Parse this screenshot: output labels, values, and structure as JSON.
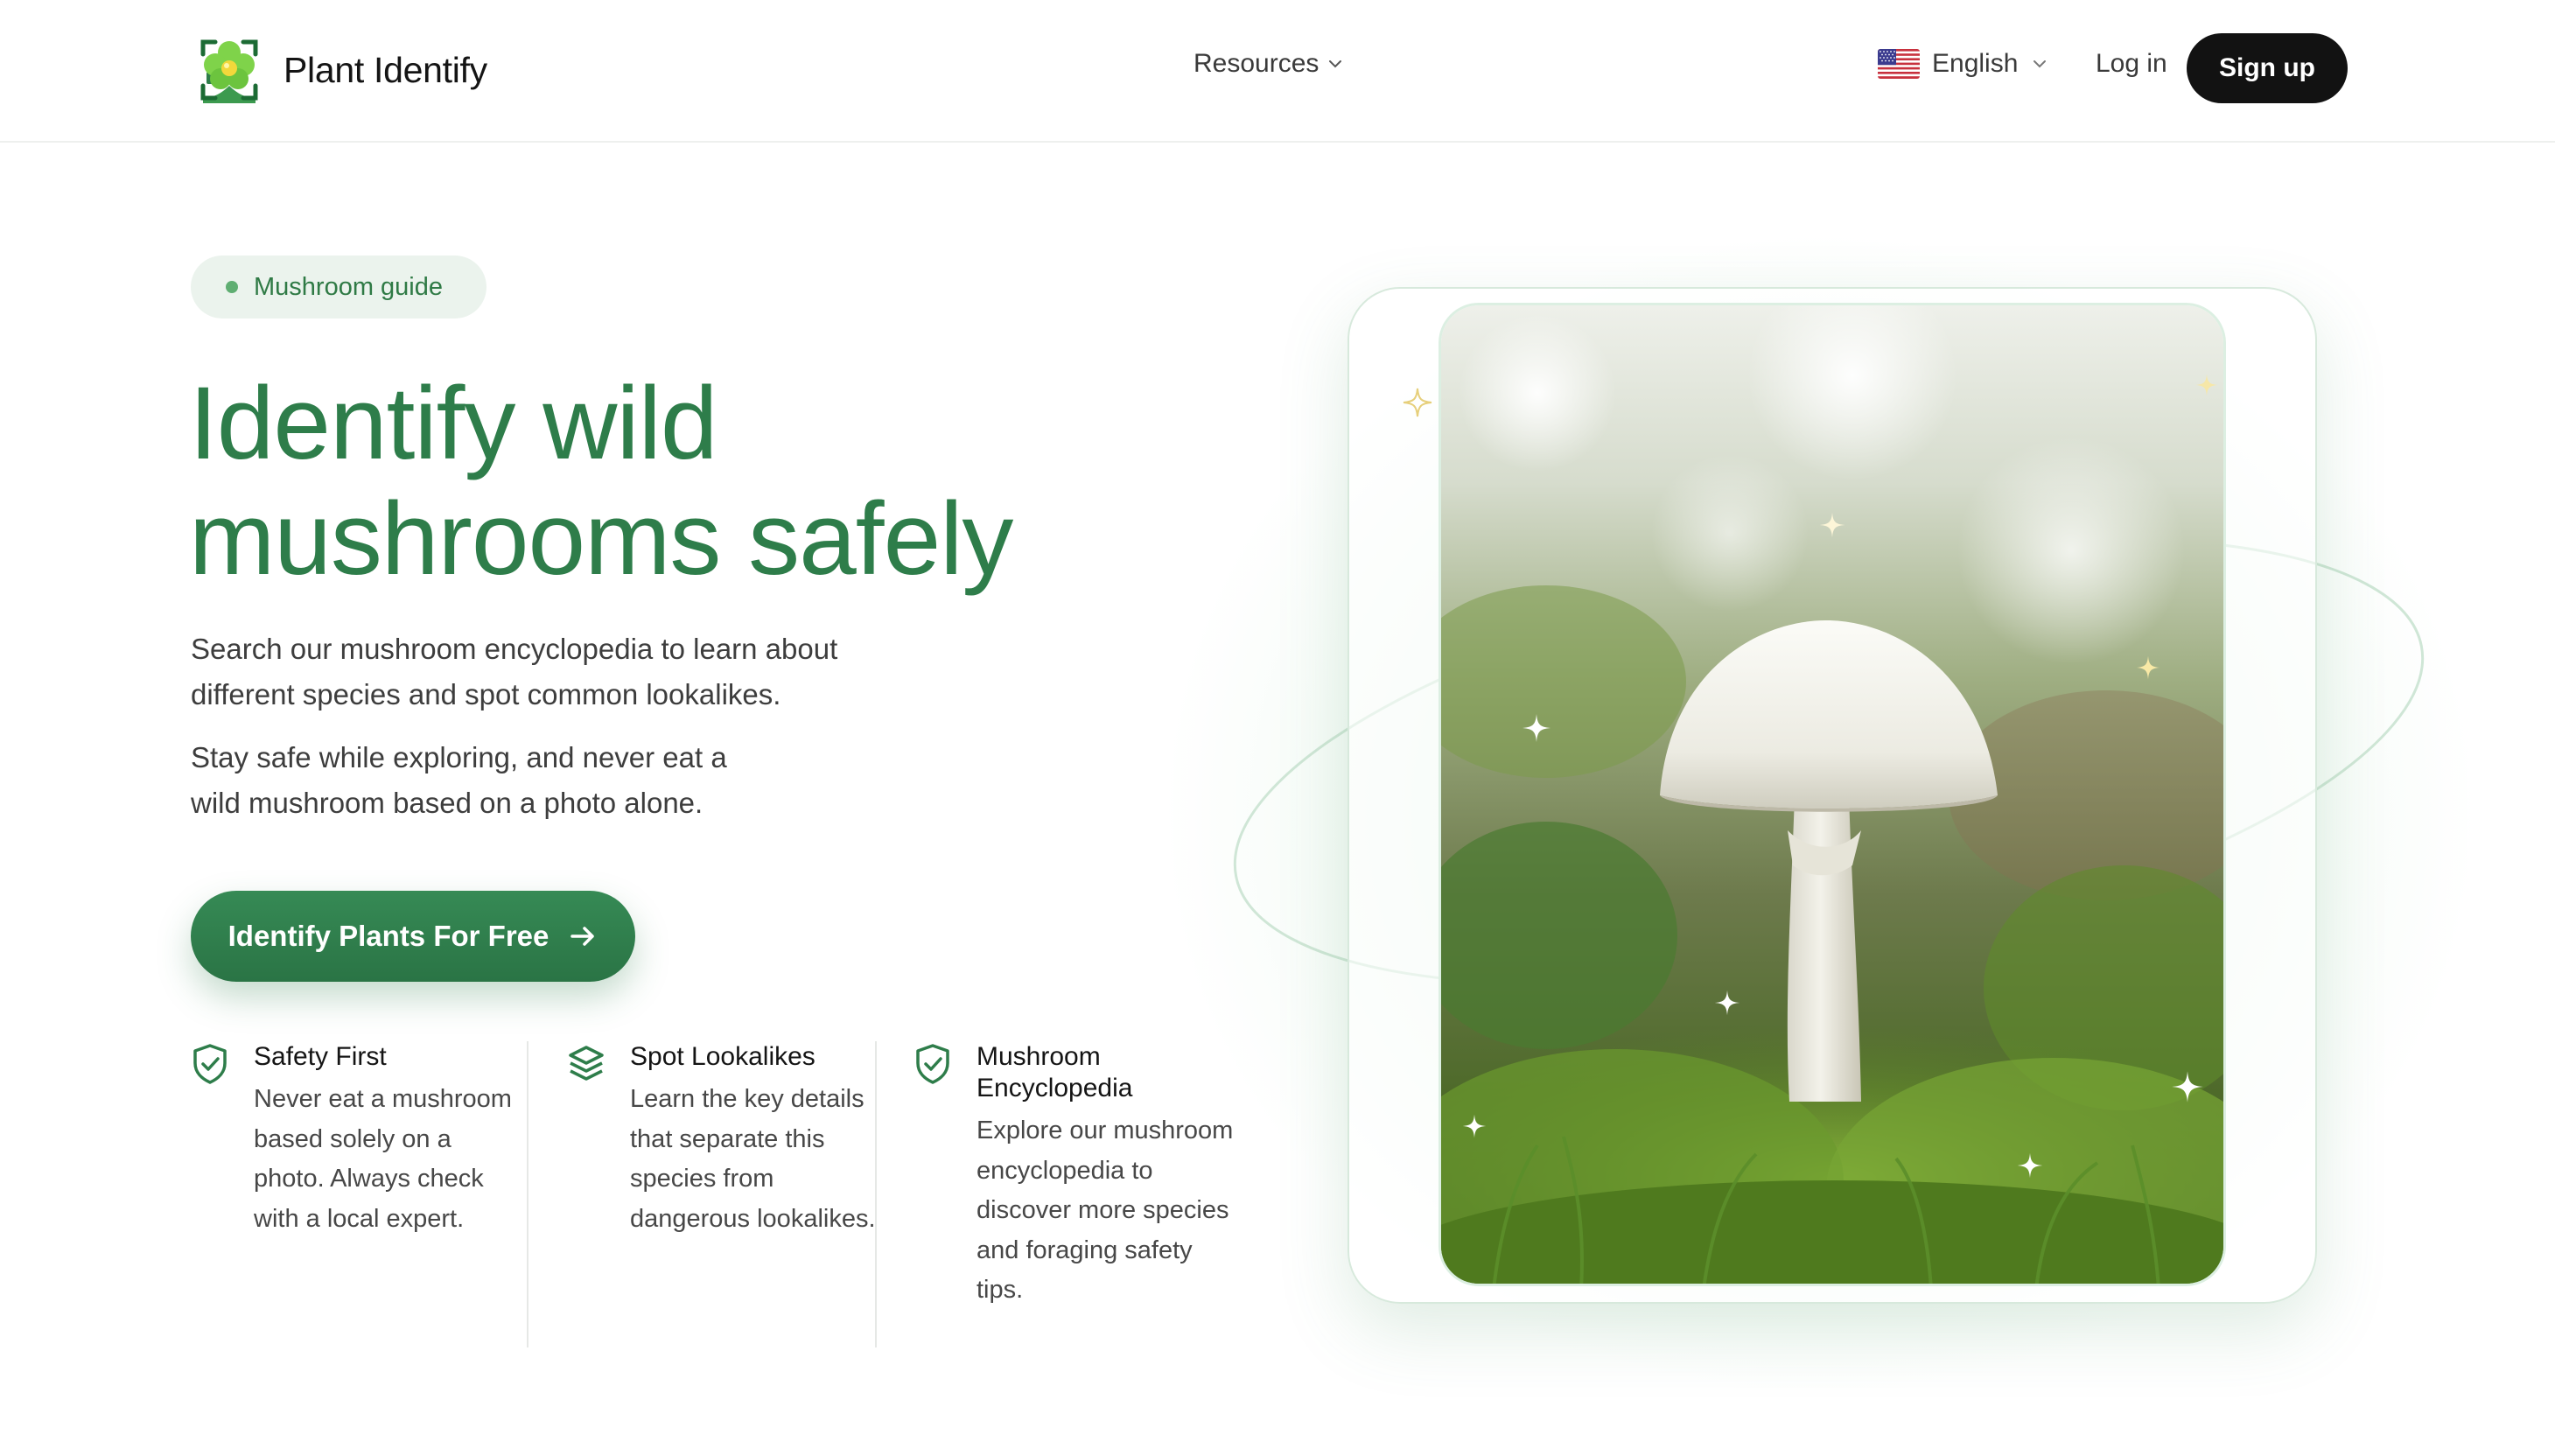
{
  "header": {
    "brand_name": "Plant Identify",
    "logo_icon": "flower-logo-icon",
    "nav_resources": "Resources",
    "language": "English",
    "flag_icon": "us-flag-icon",
    "login": "Log in",
    "signup": "Sign up"
  },
  "hero": {
    "badge": "Mushroom guide",
    "headline_line1": "Identify wild",
    "headline_line2": "mushrooms safely",
    "para1_line1": "Search our mushroom encyclopedia to learn about",
    "para1_line2": "different species and spot common lookalikes.",
    "para2_line1": "Stay safe while exploring, and never eat a",
    "para2_line2": "wild mushroom based on a photo alone.",
    "cta_label": "Identify Plants For Free",
    "cta_icon": "arrow-right-icon"
  },
  "features": [
    {
      "icon": "shield-check-icon",
      "title": "Safety First",
      "text": "Never eat a mushroom based solely on a photo. Always check with a local expert."
    },
    {
      "icon": "layers-icon",
      "title": "Spot Lookalikes",
      "text": "Learn the key details that separate this species from dangerous lookalikes."
    },
    {
      "icon": "shield-check-icon",
      "title": "Mushroom Encyclopedia",
      "text": "Explore our mushroom encyclopedia to discover more species and foraging safety tips."
    }
  ],
  "colors": {
    "brand_green": "#2e7d4a",
    "badge_bg": "#ebf3ed",
    "signup_bg": "#121212",
    "cta_bg": "#2f7d4b"
  }
}
